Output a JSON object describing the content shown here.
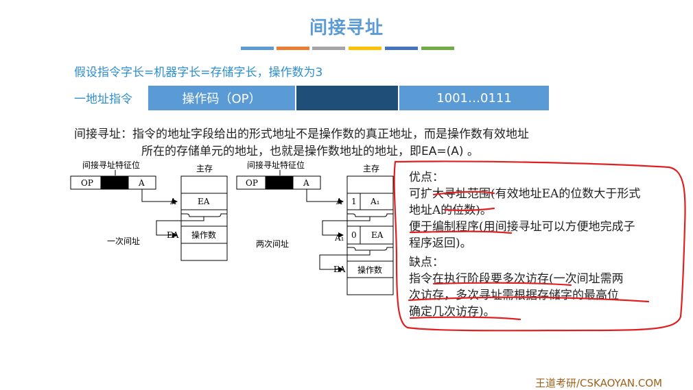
{
  "title": "间接寻址",
  "color_bar": [
    "#5b9bd5",
    "#ed7d31",
    "#a5a5a5",
    "#ffc000",
    "#4472c4",
    "#70ad47"
  ],
  "assumption": "假设指令字长=机器字长=存储字长，操作数为3",
  "instruction": {
    "label": "一地址指令",
    "opcode": "操作码（OP）",
    "address": "1001…0111"
  },
  "description": {
    "line1": "间接寻址：指令的地址字段给出的形式地址不是操作数的真正地址，而是操作数有效地址",
    "line2": "所在的存储单元的地址，也就是操作数地址的地址，即EA=(A) 。"
  },
  "diagram_left": {
    "flag_label": "间接寻址特征位",
    "op": "OP",
    "a": "A",
    "memory_label": "主存",
    "arrow_a": "A",
    "cell_ea": "EA",
    "arrow_ea": "EA",
    "cell_operand": "操作数",
    "caption": "一次间址"
  },
  "diagram_right": {
    "flag_label": "间接寻址特征位",
    "op": "OP",
    "a": "A",
    "memory_label": "主存",
    "arrow_a": "A",
    "bit1": "1",
    "cell_a1": "A₁",
    "arrow_a1": "A₁",
    "bit0": "0",
    "cell_ea": "EA",
    "arrow_ea": "EA",
    "cell_operand": "操作数",
    "caption": "两次间址"
  },
  "notes": {
    "adv_title": "优点：",
    "adv1_l1": "可扩大寻址范围(有效地址EA的位数大于形式",
    "adv1_l2": "地址A的位数)。",
    "adv2_l1": "便于编制程序(用间接寻址可以方便地完成子",
    "adv2_l2": "程序返回)。",
    "dis_title": "缺点：",
    "dis1_l1": "指令在执行阶段要多次访存(一次间址需两",
    "dis1_l2": "次访存，多次寻址需根据存储字的最高位",
    "dis1_l3": "确定几次访存)。"
  },
  "footer": "王道考研/CSKAOYAN.COM",
  "annotation_color": "#e02020"
}
